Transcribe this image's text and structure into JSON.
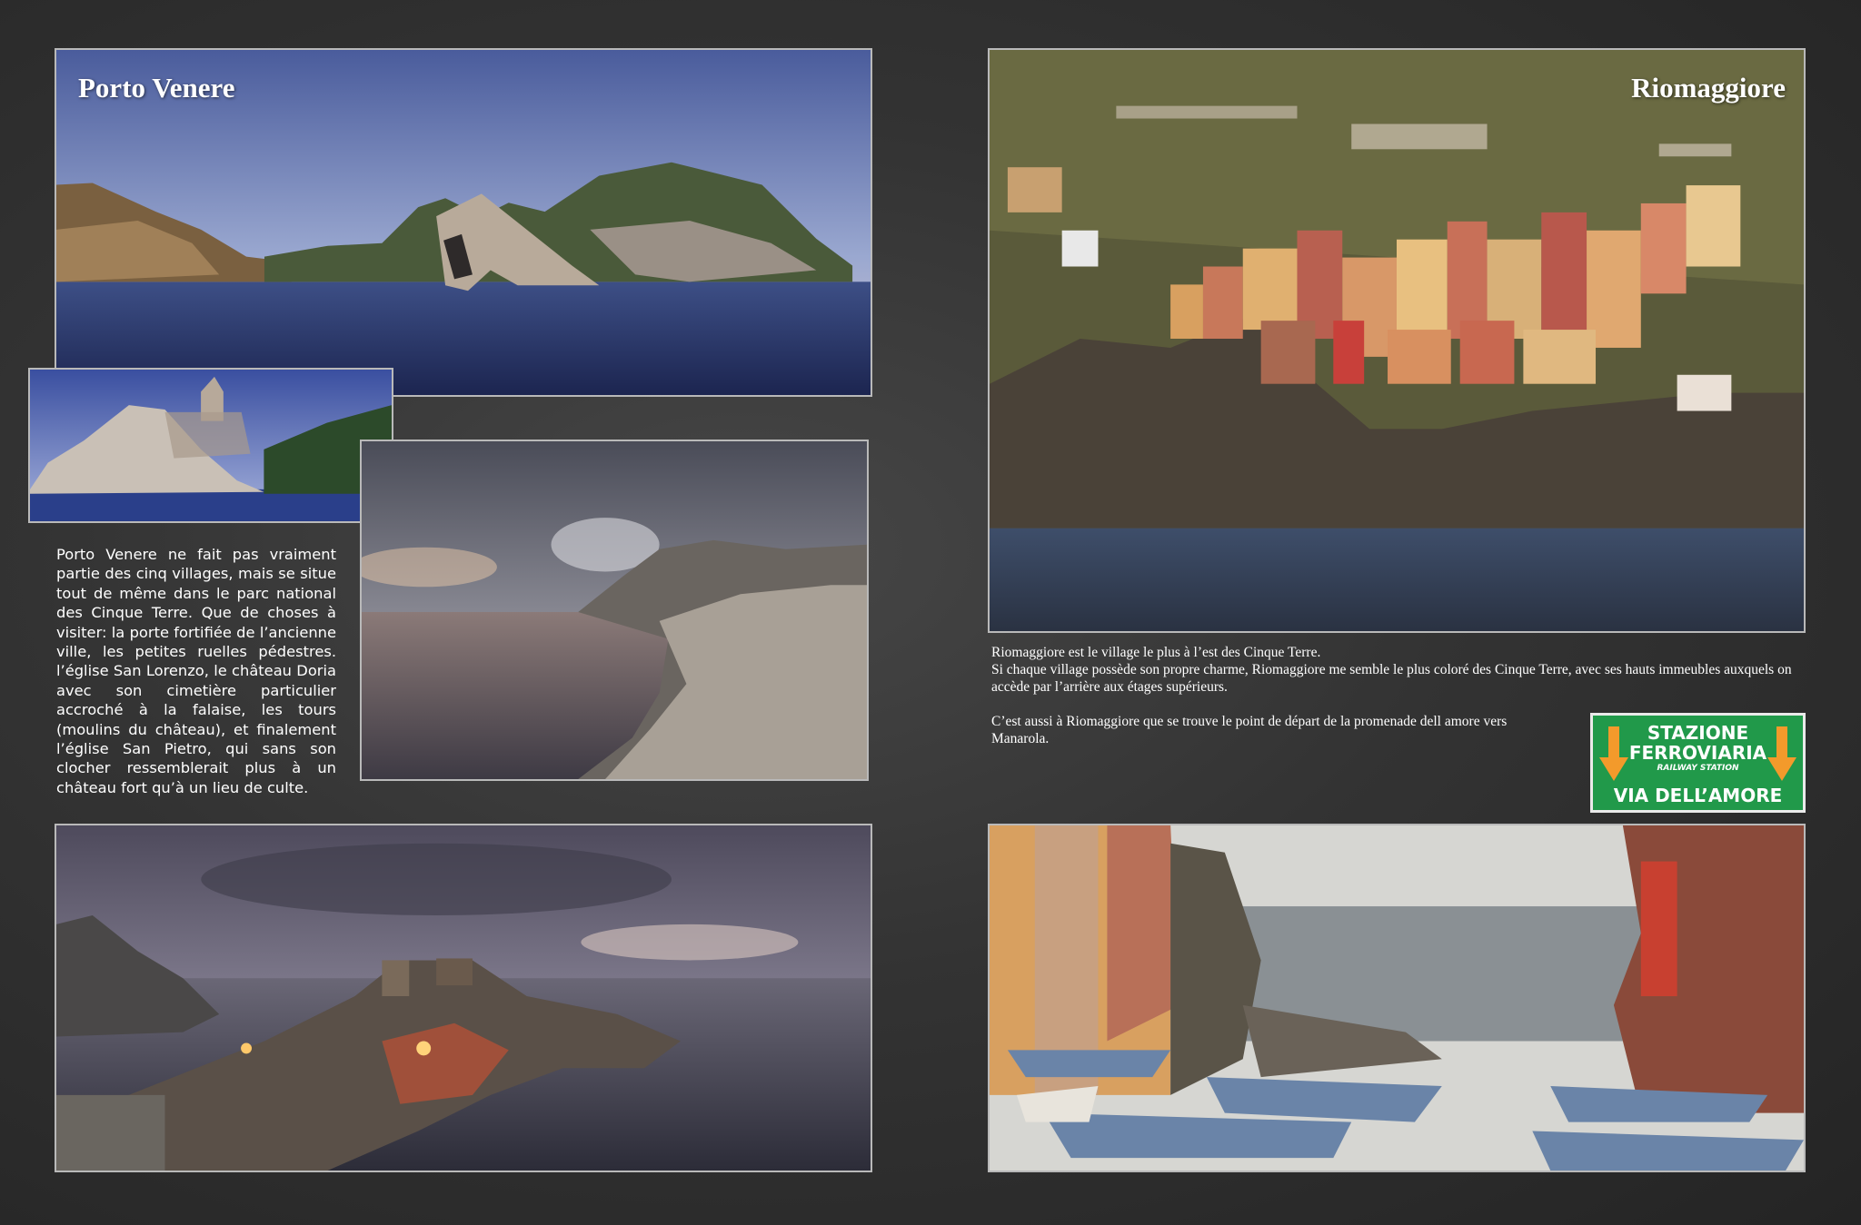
{
  "left_page": {
    "title": "Porto Venere",
    "body": "Porto Venere ne fait pas vraiment partie des cinq villages, mais se situe tout de même dans le parc national des Cinque Terre. Que de choses à visiter: la porte fortifiée de l’ancienne ville, les petites ruelles pédestres. l’église San Lorenzo, le château Doria avec son cimetière particulier accroché à la falaise, les tours (moulins du château), et finalement l’église San Pietro, qui sans son clocher ressemblerait plus à un château fort qu’à un lieu de culte."
  },
  "right_page": {
    "title": "Riomaggiore",
    "paragraph1": "Riomaggiore est le village le plus à l’est des Cinque Terre.\nSi chaque village possède son propre charme, Riomaggiore me semble le plus coloré des Cinque Terre, avec ses hauts immeubles auxquels on accède par l’arrière aux étages supérieurs.",
    "paragraph2": "C’est aussi à Riomaggiore que se trouve le point de départ de la promenade dell amore vers Manarola."
  },
  "sign": {
    "line1": "STAZIONE",
    "line2": "FERROVIARIA",
    "line3": "RAILWAY STATION",
    "line4": "VIA DELL’AMORE",
    "background": "#21994a",
    "arrow_color": "#f39a2b"
  }
}
